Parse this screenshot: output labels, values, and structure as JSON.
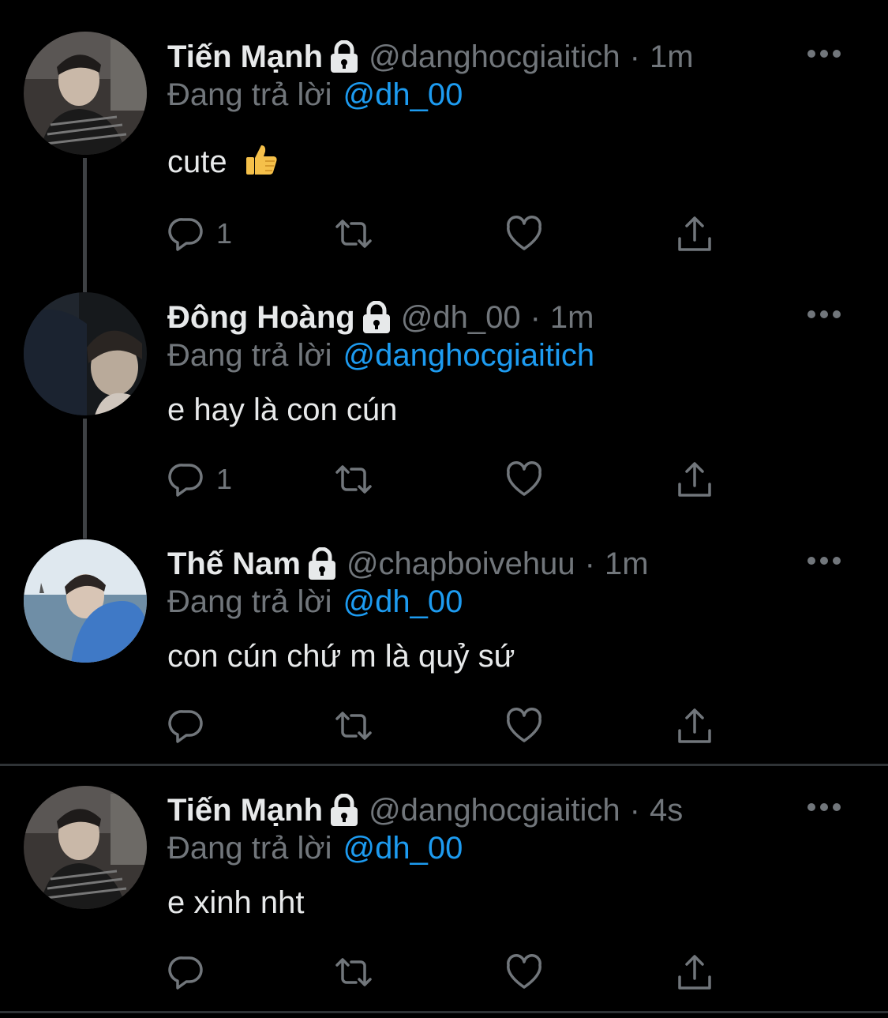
{
  "colors": {
    "background": "#000000",
    "text": "#e7e9ea",
    "secondary": "#71767b",
    "mention": "#1d9bf0",
    "thread_line": "#3e4144",
    "divider": "#2f3336"
  },
  "reply_label": "Đang trả lời",
  "tweets": [
    {
      "name": "Tiến Mạnh",
      "handle": "@danghocgiaitich",
      "separator": "·",
      "time": "1m",
      "replying_to": "@dh_00",
      "text": "cute",
      "emoji": "thumbs-up",
      "reply_count": "1",
      "avatar": "avatar-photo-boy-striped-shirt"
    },
    {
      "name": "Đông Hoàng",
      "handle": "@dh_00",
      "separator": "·",
      "time": "1m",
      "replying_to": "@danghocgiaitich",
      "text": "e hay là con cún",
      "reply_count": "1",
      "avatar": "avatar-photo-smiling-boy"
    },
    {
      "name": "Thế Nam",
      "handle": "@chapboivehuu",
      "separator": "·",
      "time": "1m",
      "replying_to": "@dh_00",
      "text": "con cún chứ m là quỷ sứ",
      "reply_count": "",
      "avatar": "avatar-photo-boy-by-sea"
    },
    {
      "name": "Tiến Mạnh",
      "handle": "@danghocgiaitich",
      "separator": "·",
      "time": "4s",
      "replying_to": "@dh_00",
      "text": "e xinh nht",
      "reply_count": "",
      "avatar": "avatar-photo-boy-striped-shirt"
    }
  ]
}
